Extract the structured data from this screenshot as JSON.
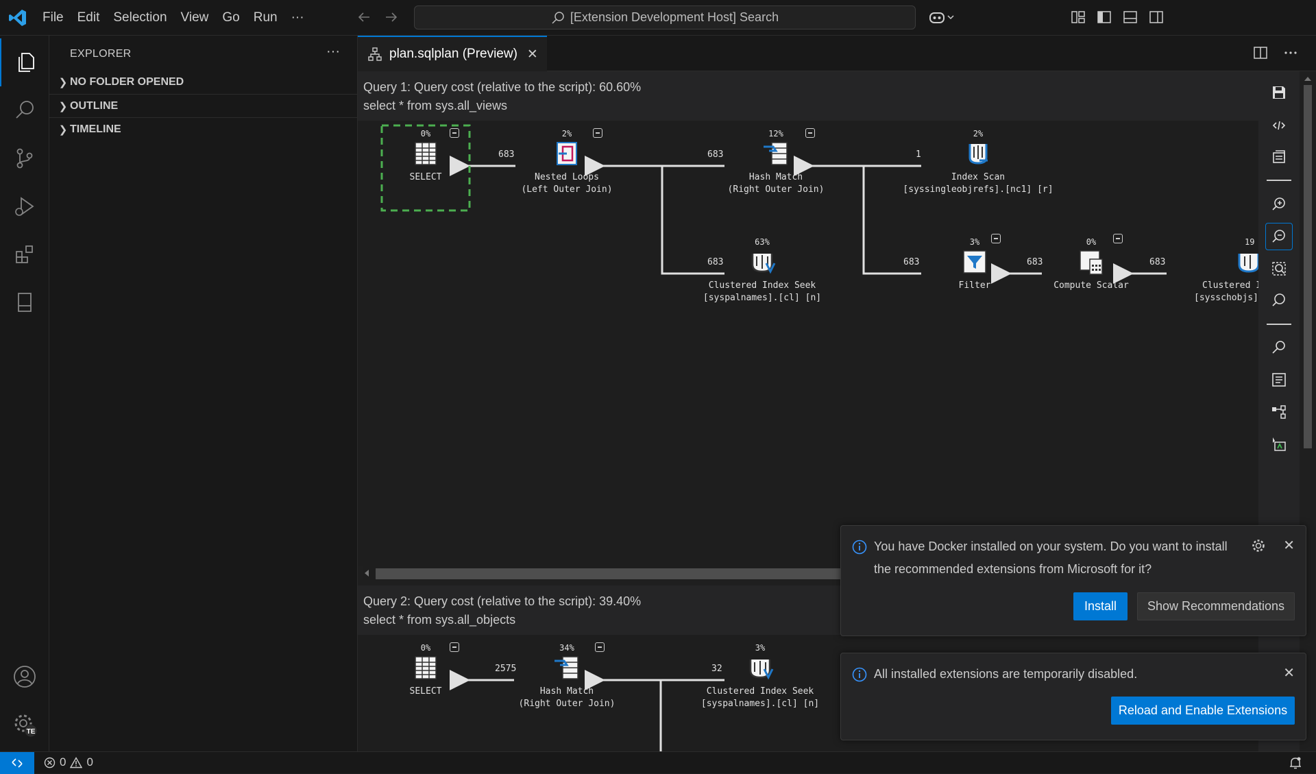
{
  "menu": [
    "File",
    "Edit",
    "Selection",
    "View",
    "Go",
    "Run",
    "···"
  ],
  "search": {
    "text": "[Extension Development Host] Search"
  },
  "sidebar": {
    "title": "EXPLORER",
    "more": "···",
    "sections": [
      "NO FOLDER OPENED",
      "OUTLINE",
      "TIMELINE"
    ]
  },
  "tab": {
    "label": "plan.sqlplan (Preview)",
    "close": "✕"
  },
  "query1": {
    "cost": "Query 1: Query cost (relative to the script): 60.60%",
    "sql": "select * from sys.all_views",
    "nodes": [
      {
        "pct": "0%",
        "name": "SELECT",
        "sub": ""
      },
      {
        "pct": "2%",
        "name": "Nested Loops",
        "sub": "(Left Outer Join)"
      },
      {
        "pct": "12%",
        "name": "Hash Match",
        "sub": "(Right Outer Join)"
      },
      {
        "pct": "2%",
        "name": "Index Scan",
        "sub": "[syssingleobjrefs].[nc1] [r]"
      },
      {
        "pct": "63%",
        "name": "Clustered Index Seek",
        "sub": "[syspalnames].[cl] [n]"
      },
      {
        "pct": "3%",
        "name": "Filter",
        "sub": ""
      },
      {
        "pct": "0%",
        "name": "Compute Scalar",
        "sub": ""
      },
      {
        "pct": "19",
        "name": "Clustered I",
        "sub": "[sysschobjs]"
      }
    ],
    "rows": [
      "683",
      "683",
      "1",
      "683",
      "683",
      "683",
      "683"
    ]
  },
  "query2": {
    "cost": "Query 2: Query cost (relative to the script): 39.40%",
    "sql": "select * from sys.all_objects",
    "nodes": [
      {
        "pct": "0%",
        "name": "SELECT",
        "sub": ""
      },
      {
        "pct": "34%",
        "name": "Hash Match",
        "sub": "(Right Outer Join)"
      },
      {
        "pct": "3%",
        "name": "Clustered Index Seek",
        "sub": "[syspalnames].[cl] [n]"
      }
    ],
    "rows": [
      "2575",
      "32"
    ]
  },
  "notifications": [
    {
      "message": "You have Docker installed on your system. Do you want to install the recommended extensions from Microsoft for it?",
      "primary": "Install",
      "secondary": "Show Recommendations"
    },
    {
      "message": "All installed extensions are temporarily disabled.",
      "primary": "Reload and Enable Extensions"
    }
  ],
  "status": {
    "errors": "0",
    "warnings": "0"
  },
  "account_badge": "TE",
  "colors": {
    "accent": "#0078d4",
    "selection": "#4caf50"
  }
}
